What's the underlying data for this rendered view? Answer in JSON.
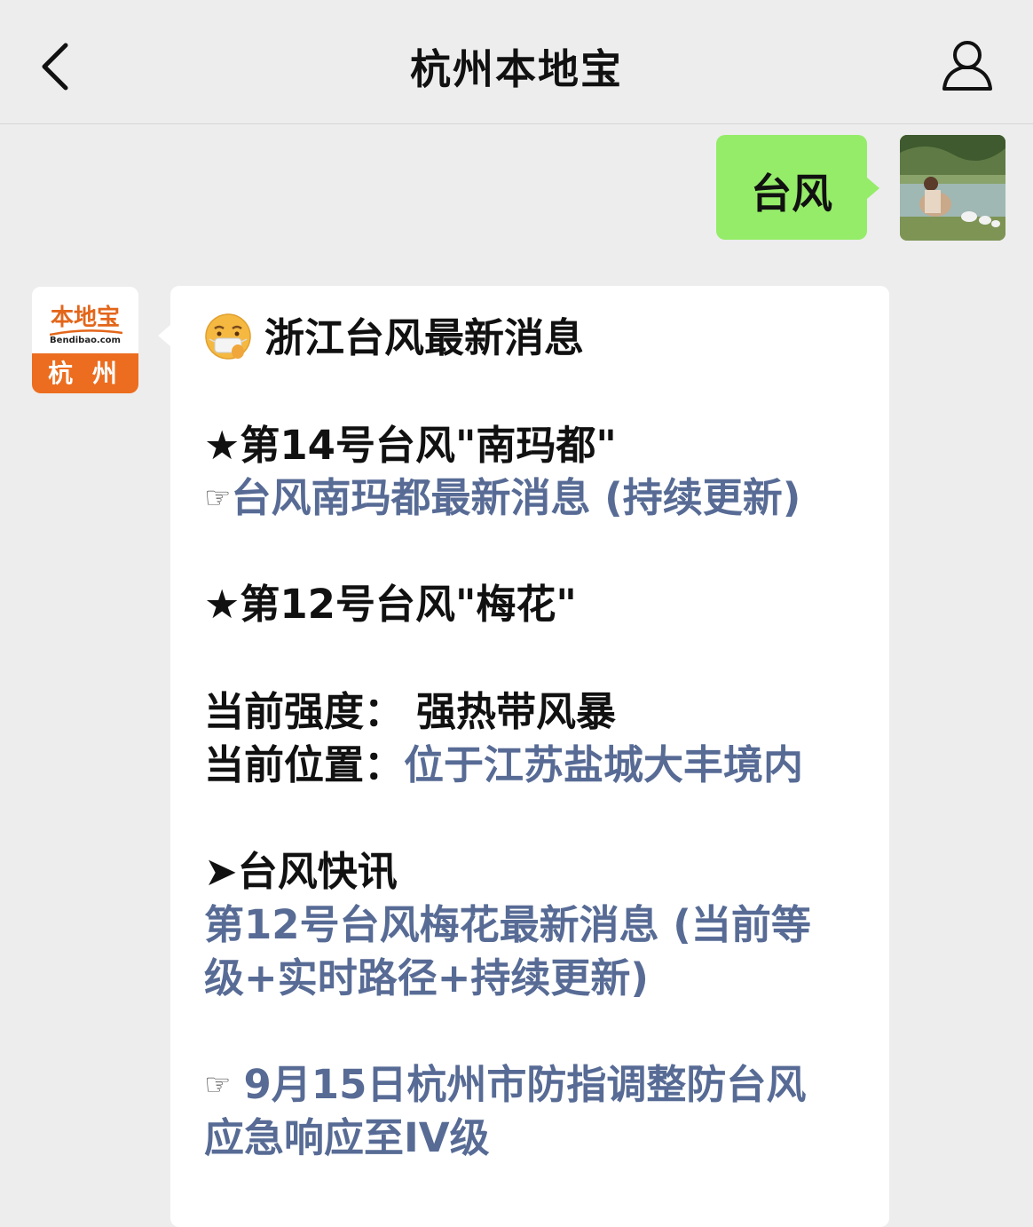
{
  "header": {
    "title": "杭州本地宝"
  },
  "outgoing": {
    "text": "台风"
  },
  "bot": {
    "avatar_brand": "本地宝",
    "avatar_domain": "Bendibao.com",
    "avatar_city": "杭 州"
  },
  "message": {
    "heading": "浙江台风最新消息",
    "typhoon14_title": "★第14号台风\"南玛都\"",
    "typhoon14_pointer": "☞",
    "typhoon14_link": "台风南玛都最新消息 (持续更新)",
    "typhoon12_title": "★第12号台风\"梅花\"",
    "strength_label": "当前强度：",
    "strength_value": "强热带风暴",
    "position_label": "当前位置：",
    "position_value": "位于江苏盐城大丰境内",
    "news_title": "➤台风快讯",
    "news_link_line1": "第12号台风梅花最新消息 (当前等",
    "news_link_line2": "级+实时路径+持续更新)",
    "notice_pointer": "☞",
    "notice_link_line1": "9月15日杭州市防指调整防台风",
    "notice_link_line2": "应急响应至IV级"
  },
  "colors": {
    "background": "#ededed",
    "outgoing_bubble": "#95ec69",
    "incoming_bubble": "#ffffff",
    "link": "#576b95",
    "brand_orange": "#ec6d1f"
  },
  "icons": {
    "back": "chevron-left-icon",
    "profile": "person-icon",
    "emoji": "mask-face-emoji-icon"
  }
}
